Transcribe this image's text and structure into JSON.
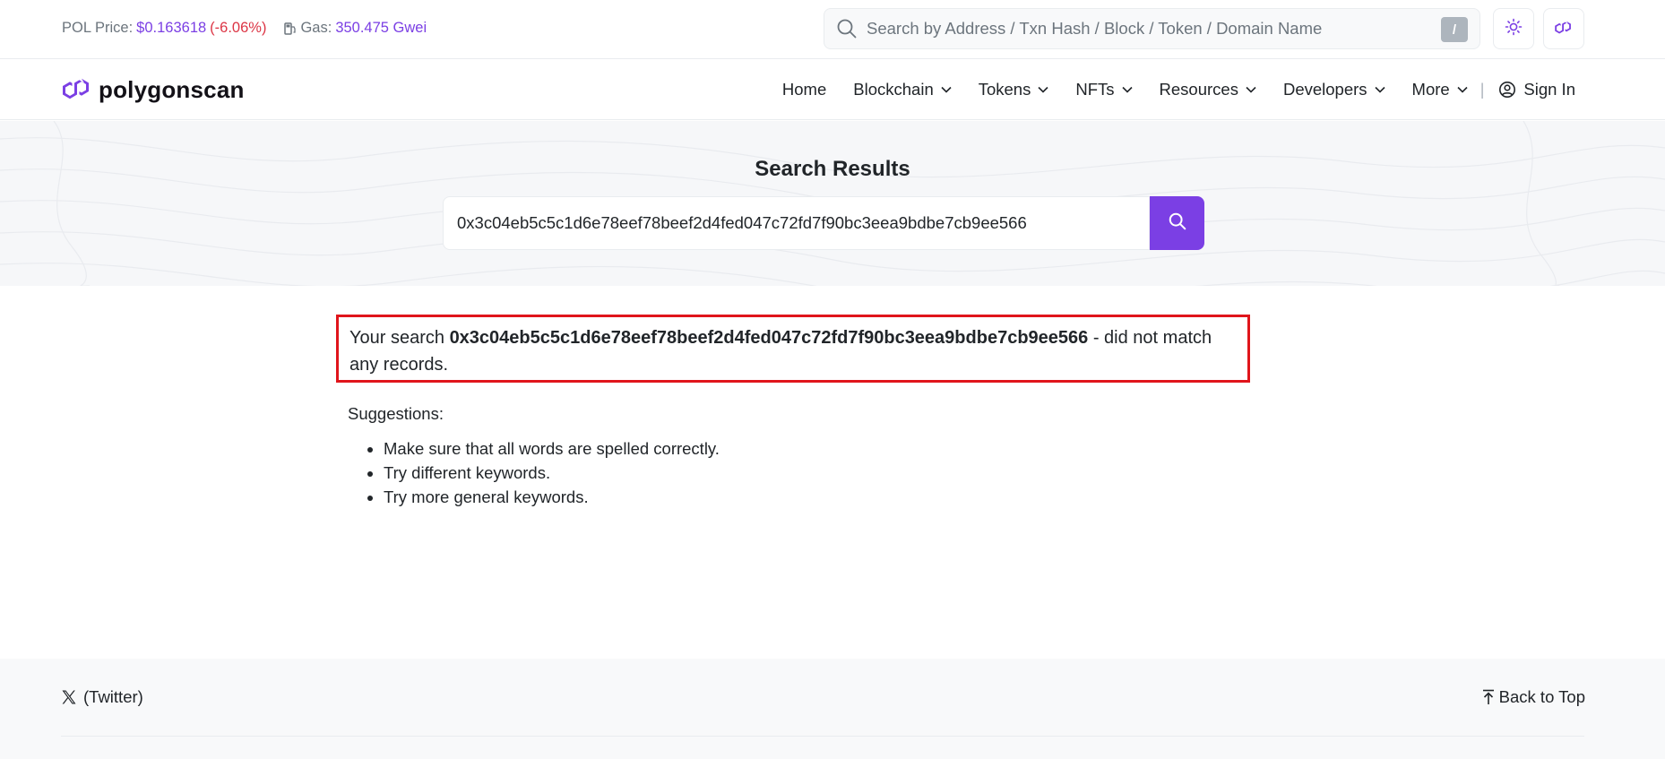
{
  "topbar": {
    "price_label": "POL Price:",
    "price_value": "$0.163618",
    "price_change": "(-6.06%)",
    "gas_label": "Gas:",
    "gas_value": "350.475 Gwei",
    "search_placeholder": "Search by Address / Txn Hash / Block / Token / Domain Name",
    "search_shortcut": "/",
    "icons": [
      "search-icon",
      "sun-icon",
      "polygon-icon"
    ]
  },
  "navbar": {
    "logo_text": "polygonscan",
    "items": [
      {
        "label": "Home",
        "dropdown": false
      },
      {
        "label": "Blockchain",
        "dropdown": true
      },
      {
        "label": "Tokens",
        "dropdown": true
      },
      {
        "label": "NFTs",
        "dropdown": true
      },
      {
        "label": "Resources",
        "dropdown": true
      },
      {
        "label": "Developers",
        "dropdown": true
      },
      {
        "label": "More",
        "dropdown": true
      }
    ],
    "separator": "|",
    "signin_label": "Sign In"
  },
  "hero": {
    "title": "Search Results",
    "search_value": "0x3c04eb5c5c1d6e78eef78beef2d4fed047c72fd7f90bc3eea9bdbe7cb9ee566"
  },
  "result": {
    "prefix": "Your search ",
    "query": "0x3c04eb5c5c1d6e78eef78beef2d4fed047c72fd7f90bc3eea9bdbe7cb9ee566",
    "suffix": " - did not match any records."
  },
  "suggestions": {
    "title": "Suggestions:",
    "items": [
      "Make sure that all words are spelled correctly.",
      "Try different keywords.",
      "Try more general keywords."
    ]
  },
  "footer": {
    "twitter_label": "(Twitter)",
    "back_to_top_label": "Back to Top"
  },
  "colors": {
    "accent": "#7b3fe4",
    "negative": "#dc3545",
    "highlight_border": "#e0151b"
  }
}
